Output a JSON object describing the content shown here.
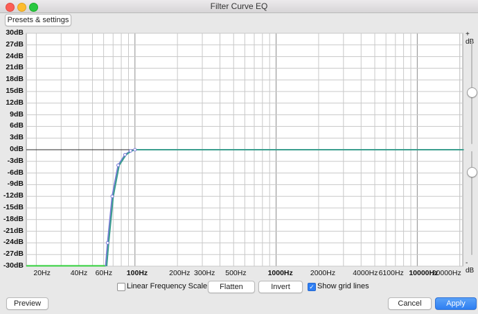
{
  "window": {
    "title": "Filter Curve EQ"
  },
  "toolbar": {
    "presets_label": "Presets & settings"
  },
  "graph": {
    "y_ticks": [
      "30dB",
      "27dB",
      "24dB",
      "21dB",
      "18dB",
      "15dB",
      "12dB",
      "9dB",
      "6dB",
      "3dB",
      "0dB",
      "-3dB",
      "-6dB",
      "-9dB",
      "-12dB",
      "-15dB",
      "-18dB",
      "-21dB",
      "-24dB",
      "-27dB",
      "-30dB"
    ],
    "y_values": [
      30,
      27,
      24,
      21,
      18,
      15,
      12,
      9,
      6,
      3,
      0,
      -3,
      -6,
      -9,
      -12,
      -15,
      -18,
      -21,
      -24,
      -27,
      -30
    ],
    "x_ticks": [
      {
        "freq": 20,
        "label": "20Hz",
        "bold": false
      },
      {
        "freq": 40,
        "label": "40Hz",
        "bold": false
      },
      {
        "freq": 60,
        "label": "60Hz",
        "bold": false
      },
      {
        "freq": 100,
        "label": "100Hz",
        "bold": true
      },
      {
        "freq": 200,
        "label": "200Hz",
        "bold": false
      },
      {
        "freq": 300,
        "label": "300Hz",
        "bold": false
      },
      {
        "freq": 500,
        "label": "500Hz",
        "bold": false
      },
      {
        "freq": 1000,
        "label": "1000Hz",
        "bold": true
      },
      {
        "freq": 2000,
        "label": "2000Hz",
        "bold": false
      },
      {
        "freq": 4000,
        "label": "4000Hz",
        "bold": false
      },
      {
        "freq": 6100,
        "label": "6100Hz",
        "bold": false
      },
      {
        "freq": 10000,
        "label": "10000Hz",
        "bold": true
      },
      {
        "freq": 20000,
        "label": "20000Hz",
        "bold": false
      }
    ],
    "x_range": [
      17,
      21000
    ],
    "y_range": [
      -30,
      30
    ],
    "curve_points": [
      {
        "freq": 62,
        "db": -30
      },
      {
        "freq": 64,
        "db": -24
      },
      {
        "freq": 69,
        "db": -12
      },
      {
        "freq": 76,
        "db": -4
      },
      {
        "freq": 85,
        "db": -1.3
      },
      {
        "freq": 93,
        "db": -0.3
      },
      {
        "freq": 100,
        "db": 0
      },
      {
        "freq": 21000,
        "db": 0
      }
    ],
    "curve_color": "#3a9e8e",
    "handle_color": "#7a7ad8",
    "floor_color": "#2fcf3a"
  },
  "sliders": {
    "top_label": "+ dB",
    "bottom_label": "- dB",
    "top_level_db": 0,
    "bottom_level_db": 0
  },
  "controls": {
    "linear_label": "Linear Frequency Scale",
    "linear_checked": false,
    "flatten_label": "Flatten",
    "invert_label": "Invert",
    "grid_label": "Show grid lines",
    "grid_checked": true
  },
  "footer": {
    "preview_label": "Preview",
    "cancel_label": "Cancel",
    "apply_label": "Apply"
  }
}
